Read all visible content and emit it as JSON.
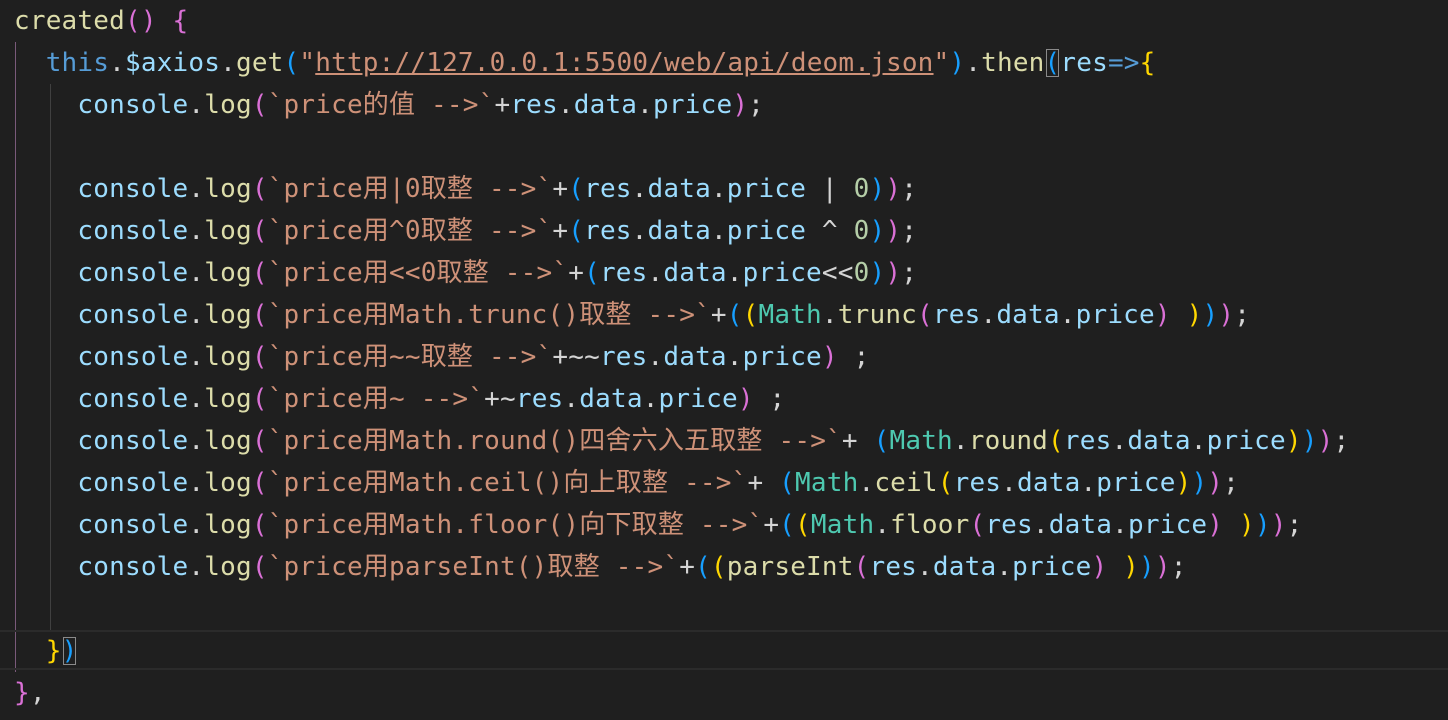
{
  "editor": {
    "language": "javascript",
    "lines": [
      [
        {
          "t": "created",
          "c": "k-func"
        },
        {
          "t": "() ",
          "c": "k-b2"
        },
        {
          "t": "{",
          "c": "k-b2"
        }
      ],
      [
        {
          "t": "  this",
          "c": "k-kw"
        },
        {
          "t": ".",
          "c": "k-op"
        },
        {
          "t": "$axios",
          "c": "k-var"
        },
        {
          "t": ".",
          "c": "k-op"
        },
        {
          "t": "get",
          "c": "k-func"
        },
        {
          "t": "(",
          "c": "k-b3"
        },
        {
          "t": "\"",
          "c": "k-str"
        },
        {
          "t": "http://127.0.0.1:5500/web/api/deom.json",
          "c": "k-str underline"
        },
        {
          "t": "\"",
          "c": "k-str"
        },
        {
          "t": ")",
          "c": "k-b3"
        },
        {
          "t": ".",
          "c": "k-op"
        },
        {
          "t": "then",
          "c": "k-func"
        },
        {
          "t": "(",
          "c": "k-b3 boxed"
        },
        {
          "t": "res",
          "c": "k-var"
        },
        {
          "t": "=>",
          "c": "k-kw"
        },
        {
          "t": "{",
          "c": "k-b1"
        }
      ],
      [
        {
          "t": "    console",
          "c": "k-var"
        },
        {
          "t": ".",
          "c": "k-op"
        },
        {
          "t": "log",
          "c": "k-func"
        },
        {
          "t": "(",
          "c": "k-b2"
        },
        {
          "t": "`price的值 -->`",
          "c": "k-str"
        },
        {
          "t": "+",
          "c": "k-op"
        },
        {
          "t": "res",
          "c": "k-var"
        },
        {
          "t": ".",
          "c": "k-op"
        },
        {
          "t": "data",
          "c": "k-var"
        },
        {
          "t": ".",
          "c": "k-op"
        },
        {
          "t": "price",
          "c": "k-var"
        },
        {
          "t": ")",
          "c": "k-b2"
        },
        {
          "t": ";",
          "c": "k-op"
        }
      ],
      [
        {
          "t": "",
          "c": "k-op"
        }
      ],
      [
        {
          "t": "    console",
          "c": "k-var"
        },
        {
          "t": ".",
          "c": "k-op"
        },
        {
          "t": "log",
          "c": "k-func"
        },
        {
          "t": "(",
          "c": "k-b2"
        },
        {
          "t": "`price用|0取整 -->`",
          "c": "k-str"
        },
        {
          "t": "+",
          "c": "k-op"
        },
        {
          "t": "(",
          "c": "k-b3"
        },
        {
          "t": "res",
          "c": "k-var"
        },
        {
          "t": ".",
          "c": "k-op"
        },
        {
          "t": "data",
          "c": "k-var"
        },
        {
          "t": ".",
          "c": "k-op"
        },
        {
          "t": "price",
          "c": "k-var"
        },
        {
          "t": " | ",
          "c": "k-op"
        },
        {
          "t": "0",
          "c": "k-num"
        },
        {
          "t": ")",
          "c": "k-b3"
        },
        {
          "t": ")",
          "c": "k-b2"
        },
        {
          "t": ";",
          "c": "k-op"
        }
      ],
      [
        {
          "t": "    console",
          "c": "k-var"
        },
        {
          "t": ".",
          "c": "k-op"
        },
        {
          "t": "log",
          "c": "k-func"
        },
        {
          "t": "(",
          "c": "k-b2"
        },
        {
          "t": "`price用^0取整 -->`",
          "c": "k-str"
        },
        {
          "t": "+",
          "c": "k-op"
        },
        {
          "t": "(",
          "c": "k-b3"
        },
        {
          "t": "res",
          "c": "k-var"
        },
        {
          "t": ".",
          "c": "k-op"
        },
        {
          "t": "data",
          "c": "k-var"
        },
        {
          "t": ".",
          "c": "k-op"
        },
        {
          "t": "price",
          "c": "k-var"
        },
        {
          "t": " ^ ",
          "c": "k-op"
        },
        {
          "t": "0",
          "c": "k-num"
        },
        {
          "t": ")",
          "c": "k-b3"
        },
        {
          "t": ")",
          "c": "k-b2"
        },
        {
          "t": ";",
          "c": "k-op"
        }
      ],
      [
        {
          "t": "    console",
          "c": "k-var"
        },
        {
          "t": ".",
          "c": "k-op"
        },
        {
          "t": "log",
          "c": "k-func"
        },
        {
          "t": "(",
          "c": "k-b2"
        },
        {
          "t": "`price用<<0取整 -->`",
          "c": "k-str"
        },
        {
          "t": "+",
          "c": "k-op"
        },
        {
          "t": "(",
          "c": "k-b3"
        },
        {
          "t": "res",
          "c": "k-var"
        },
        {
          "t": ".",
          "c": "k-op"
        },
        {
          "t": "data",
          "c": "k-var"
        },
        {
          "t": ".",
          "c": "k-op"
        },
        {
          "t": "price",
          "c": "k-var"
        },
        {
          "t": "<<",
          "c": "k-op"
        },
        {
          "t": "0",
          "c": "k-num"
        },
        {
          "t": ")",
          "c": "k-b3"
        },
        {
          "t": ")",
          "c": "k-b2"
        },
        {
          "t": ";",
          "c": "k-op"
        }
      ],
      [
        {
          "t": "    console",
          "c": "k-var"
        },
        {
          "t": ".",
          "c": "k-op"
        },
        {
          "t": "log",
          "c": "k-func"
        },
        {
          "t": "(",
          "c": "k-b2"
        },
        {
          "t": "`price用Math.trunc()取整 -->`",
          "c": "k-str"
        },
        {
          "t": "+",
          "c": "k-op"
        },
        {
          "t": "(",
          "c": "k-b3"
        },
        {
          "t": "(",
          "c": "k-b1"
        },
        {
          "t": "Math",
          "c": "k-cls"
        },
        {
          "t": ".",
          "c": "k-op"
        },
        {
          "t": "trunc",
          "c": "k-func"
        },
        {
          "t": "(",
          "c": "k-b2"
        },
        {
          "t": "res",
          "c": "k-var"
        },
        {
          "t": ".",
          "c": "k-op"
        },
        {
          "t": "data",
          "c": "k-var"
        },
        {
          "t": ".",
          "c": "k-op"
        },
        {
          "t": "price",
          "c": "k-var"
        },
        {
          "t": ") ",
          "c": "k-b2"
        },
        {
          "t": ")",
          "c": "k-b1"
        },
        {
          "t": ")",
          "c": "k-b3"
        },
        {
          "t": ")",
          "c": "k-b2"
        },
        {
          "t": ";",
          "c": "k-op"
        }
      ],
      [
        {
          "t": "    console",
          "c": "k-var"
        },
        {
          "t": ".",
          "c": "k-op"
        },
        {
          "t": "log",
          "c": "k-func"
        },
        {
          "t": "(",
          "c": "k-b2"
        },
        {
          "t": "`price用~~取整 -->`",
          "c": "k-str"
        },
        {
          "t": "+~~",
          "c": "k-op"
        },
        {
          "t": "res",
          "c": "k-var"
        },
        {
          "t": ".",
          "c": "k-op"
        },
        {
          "t": "data",
          "c": "k-var"
        },
        {
          "t": ".",
          "c": "k-op"
        },
        {
          "t": "price",
          "c": "k-var"
        },
        {
          "t": ")",
          "c": "k-b2"
        },
        {
          "t": " ;",
          "c": "k-op"
        }
      ],
      [
        {
          "t": "    console",
          "c": "k-var"
        },
        {
          "t": ".",
          "c": "k-op"
        },
        {
          "t": "log",
          "c": "k-func"
        },
        {
          "t": "(",
          "c": "k-b2"
        },
        {
          "t": "`price用~ -->`",
          "c": "k-str"
        },
        {
          "t": "+~",
          "c": "k-op"
        },
        {
          "t": "res",
          "c": "k-var"
        },
        {
          "t": ".",
          "c": "k-op"
        },
        {
          "t": "data",
          "c": "k-var"
        },
        {
          "t": ".",
          "c": "k-op"
        },
        {
          "t": "price",
          "c": "k-var"
        },
        {
          "t": ")",
          "c": "k-b2"
        },
        {
          "t": " ;",
          "c": "k-op"
        }
      ],
      [
        {
          "t": "    console",
          "c": "k-var"
        },
        {
          "t": ".",
          "c": "k-op"
        },
        {
          "t": "log",
          "c": "k-func"
        },
        {
          "t": "(",
          "c": "k-b2"
        },
        {
          "t": "`price用Math.round()四舍六入五取整 -->`",
          "c": "k-str"
        },
        {
          "t": "+ ",
          "c": "k-op"
        },
        {
          "t": "(",
          "c": "k-b3"
        },
        {
          "t": "Math",
          "c": "k-cls"
        },
        {
          "t": ".",
          "c": "k-op"
        },
        {
          "t": "round",
          "c": "k-func"
        },
        {
          "t": "(",
          "c": "k-b1"
        },
        {
          "t": "res",
          "c": "k-var"
        },
        {
          "t": ".",
          "c": "k-op"
        },
        {
          "t": "data",
          "c": "k-var"
        },
        {
          "t": ".",
          "c": "k-op"
        },
        {
          "t": "price",
          "c": "k-var"
        },
        {
          "t": ")",
          "c": "k-b1"
        },
        {
          "t": ")",
          "c": "k-b3"
        },
        {
          "t": ")",
          "c": "k-b2"
        },
        {
          "t": ";",
          "c": "k-op"
        }
      ],
      [
        {
          "t": "    console",
          "c": "k-var"
        },
        {
          "t": ".",
          "c": "k-op"
        },
        {
          "t": "log",
          "c": "k-func"
        },
        {
          "t": "(",
          "c": "k-b2"
        },
        {
          "t": "`price用Math.ceil()向上取整 -->`",
          "c": "k-str"
        },
        {
          "t": "+ ",
          "c": "k-op"
        },
        {
          "t": "(",
          "c": "k-b3"
        },
        {
          "t": "Math",
          "c": "k-cls"
        },
        {
          "t": ".",
          "c": "k-op"
        },
        {
          "t": "ceil",
          "c": "k-func"
        },
        {
          "t": "(",
          "c": "k-b1"
        },
        {
          "t": "res",
          "c": "k-var"
        },
        {
          "t": ".",
          "c": "k-op"
        },
        {
          "t": "data",
          "c": "k-var"
        },
        {
          "t": ".",
          "c": "k-op"
        },
        {
          "t": "price",
          "c": "k-var"
        },
        {
          "t": ")",
          "c": "k-b1"
        },
        {
          "t": ")",
          "c": "k-b3"
        },
        {
          "t": ")",
          "c": "k-b2"
        },
        {
          "t": ";",
          "c": "k-op"
        }
      ],
      [
        {
          "t": "    console",
          "c": "k-var"
        },
        {
          "t": ".",
          "c": "k-op"
        },
        {
          "t": "log",
          "c": "k-func"
        },
        {
          "t": "(",
          "c": "k-b2"
        },
        {
          "t": "`price用Math.floor()向下取整 -->`",
          "c": "k-str"
        },
        {
          "t": "+",
          "c": "k-op"
        },
        {
          "t": "(",
          "c": "k-b3"
        },
        {
          "t": "(",
          "c": "k-b1"
        },
        {
          "t": "Math",
          "c": "k-cls"
        },
        {
          "t": ".",
          "c": "k-op"
        },
        {
          "t": "floor",
          "c": "k-func"
        },
        {
          "t": "(",
          "c": "k-b2"
        },
        {
          "t": "res",
          "c": "k-var"
        },
        {
          "t": ".",
          "c": "k-op"
        },
        {
          "t": "data",
          "c": "k-var"
        },
        {
          "t": ".",
          "c": "k-op"
        },
        {
          "t": "price",
          "c": "k-var"
        },
        {
          "t": ") ",
          "c": "k-b2"
        },
        {
          "t": ")",
          "c": "k-b1"
        },
        {
          "t": ")",
          "c": "k-b3"
        },
        {
          "t": ")",
          "c": "k-b2"
        },
        {
          "t": ";",
          "c": "k-op"
        }
      ],
      [
        {
          "t": "    console",
          "c": "k-var"
        },
        {
          "t": ".",
          "c": "k-op"
        },
        {
          "t": "log",
          "c": "k-func"
        },
        {
          "t": "(",
          "c": "k-b2"
        },
        {
          "t": "`price用parseInt()取整 -->`",
          "c": "k-str"
        },
        {
          "t": "+",
          "c": "k-op"
        },
        {
          "t": "(",
          "c": "k-b3"
        },
        {
          "t": "(",
          "c": "k-b1"
        },
        {
          "t": "parseInt",
          "c": "k-func"
        },
        {
          "t": "(",
          "c": "k-b2"
        },
        {
          "t": "res",
          "c": "k-var"
        },
        {
          "t": ".",
          "c": "k-op"
        },
        {
          "t": "data",
          "c": "k-var"
        },
        {
          "t": ".",
          "c": "k-op"
        },
        {
          "t": "price",
          "c": "k-var"
        },
        {
          "t": ") ",
          "c": "k-b2"
        },
        {
          "t": ")",
          "c": "k-b1"
        },
        {
          "t": ")",
          "c": "k-b3"
        },
        {
          "t": ")",
          "c": "k-b2"
        },
        {
          "t": ";",
          "c": "k-op"
        }
      ],
      [
        {
          "t": "",
          "c": "k-op"
        }
      ],
      [
        {
          "t": "  }",
          "c": "k-b1"
        },
        {
          "t": ")",
          "c": "k-b3 boxed"
        }
      ],
      [
        {
          "t": "}",
          "c": "k-b2"
        },
        {
          "t": ",",
          "c": "k-op"
        }
      ]
    ]
  }
}
